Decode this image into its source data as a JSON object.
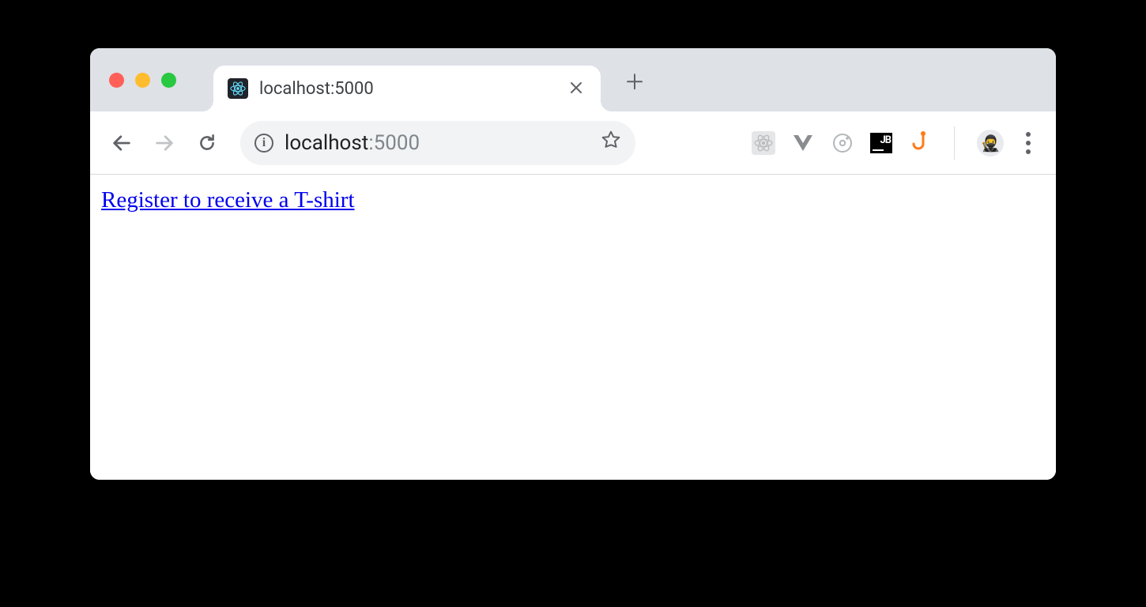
{
  "tab": {
    "title": "localhost:5000"
  },
  "address": {
    "host": "localhost",
    "port": ":5000"
  },
  "page": {
    "link_text": "Register to receive a T-shirt"
  },
  "icons": {
    "info_glyph": "i",
    "avatar_glyph": "🥷",
    "jb_label": "JB"
  }
}
